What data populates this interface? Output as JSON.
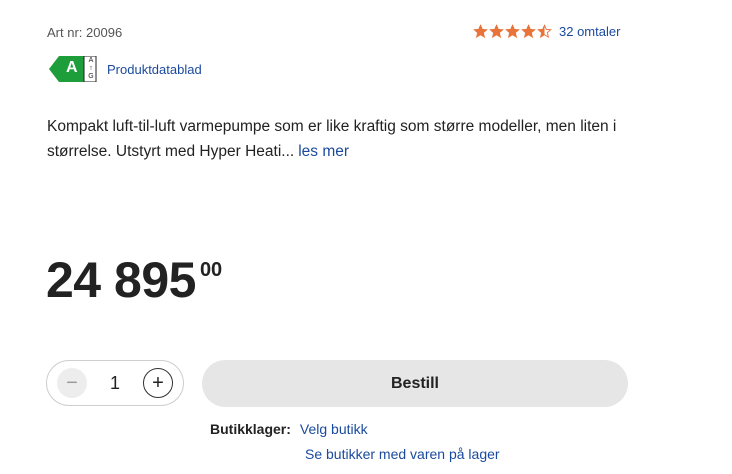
{
  "product": {
    "art_label": "Art nr:",
    "art_number": "20096",
    "rating": 4.5,
    "reviews_text": "32 omtaler",
    "energy_class": "A",
    "energy_scale_top": "A",
    "energy_scale_bottom": "G",
    "datasheet_link": "Produktdatablad",
    "description": "Kompakt luft-til-luft varmepumpe som er like kraftig som større modeller, men liten i størrelse. Utstyrt med Hyper Heati...",
    "read_more": "les mer",
    "price_main": "24 895",
    "price_cents": "00"
  },
  "purchase": {
    "quantity": "1",
    "minus_symbol": "−",
    "plus_symbol": "+",
    "order_button": "Bestill"
  },
  "stock": {
    "label": "Butikklager:",
    "choose_store": "Velg butikk",
    "see_stores": "Se butikker med varen på lager"
  },
  "colors": {
    "star": "#e8743b",
    "link": "#1a4a9e",
    "energy_green": "#1d9e3a"
  }
}
